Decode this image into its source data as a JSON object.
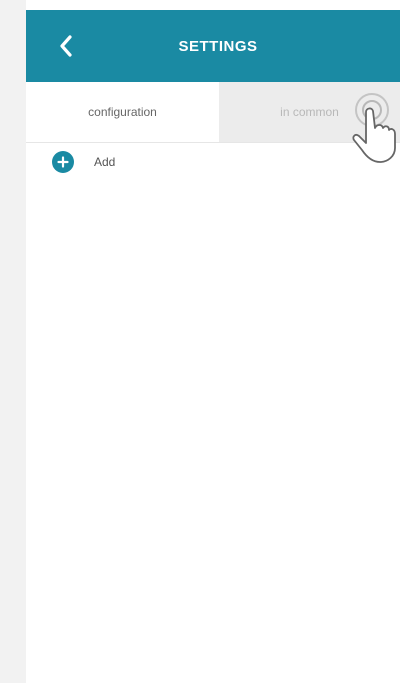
{
  "header": {
    "title": "SETTINGS",
    "back_icon": "chevron-left-icon"
  },
  "tabs": [
    {
      "label": "configuration",
      "active": true
    },
    {
      "label": "in common",
      "active": false
    }
  ],
  "add": {
    "label": "Add",
    "icon": "plus-circle-icon"
  },
  "colors": {
    "accent": "#1a8aa3",
    "tab_inactive_bg": "#ececec"
  }
}
